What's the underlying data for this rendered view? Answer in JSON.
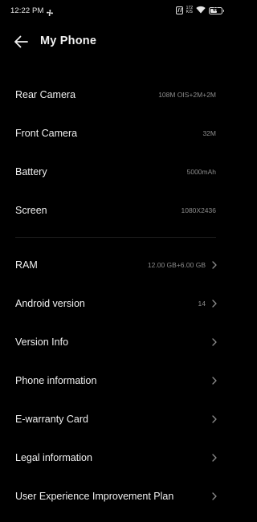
{
  "status_bar": {
    "time": "12:22 PM",
    "net_speed_top": "172",
    "net_speed_bottom": "K/S",
    "battery_level": "60",
    "battery_fraction": 0.6
  },
  "header": {
    "title": "My Phone"
  },
  "specs": [
    {
      "label": "Rear Camera",
      "value": "108M OIS+2M+2M"
    },
    {
      "label": "Front Camera",
      "value": "32M"
    },
    {
      "label": "Battery",
      "value": "5000mAh"
    },
    {
      "label": "Screen",
      "value": "1080X2436"
    }
  ],
  "menu": [
    {
      "label": "RAM",
      "value": "12.00 GB+6.00 GB"
    },
    {
      "label": "Android version",
      "value": "14"
    },
    {
      "label": "Version Info",
      "value": ""
    },
    {
      "label": "Phone information",
      "value": ""
    },
    {
      "label": "E-warranty Card",
      "value": ""
    },
    {
      "label": "Legal information",
      "value": ""
    },
    {
      "label": "User Experience Improvement Plan",
      "value": ""
    }
  ],
  "colors": {
    "background": "#000000",
    "primary_text": "#f0f0f0",
    "secondary_text": "#8c8c8c"
  }
}
